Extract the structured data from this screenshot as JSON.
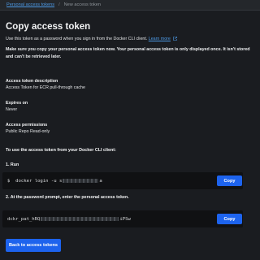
{
  "breadcrumb": {
    "parent": "Personal access tokens",
    "separator": "/",
    "current": "New access token"
  },
  "page": {
    "title": "Copy access token",
    "intro_text": "Use this token as a password when you sign in from the Docker CLI client.",
    "learn_more": "Learn more",
    "warning": "Make sure you copy your personal access token now. Your personal access token is only displayed once. It isn't stored and can't be retrieved later."
  },
  "token_details": {
    "description_label": "Access token description",
    "description_value": "Access Token for ECR pull-through cache",
    "expires_label": "Expires on",
    "expires_value": "Never",
    "permissions_label": "Access permissions",
    "permissions_value": "Public Repo Read-only"
  },
  "instructions": {
    "heading": "To use the access token from your Docker CLI client:",
    "step1_label": "1. Run",
    "step1_prompt": "$",
    "step1_command_start": "docker login -u s",
    "step1_command_end": "a",
    "step2_label": "2. At the password prompt, enter the personal access token.",
    "step2_token_start": "dckr_pat_hRQ",
    "step2_token_end": "iPSw",
    "copy_label": "Copy"
  },
  "back_button": "Back to access tokens",
  "colors": {
    "background": "#1a1c20",
    "link": "#4d9be8",
    "primary_button": "#1d63ed",
    "code_background": "#101113"
  }
}
